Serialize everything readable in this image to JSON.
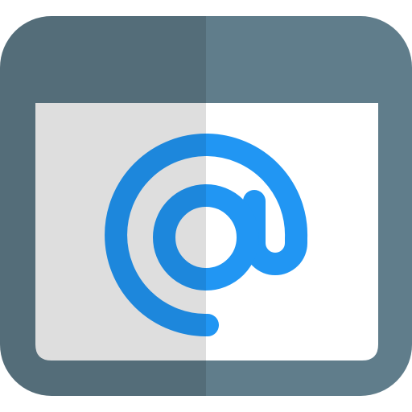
{
  "icon": {
    "name": "email-at-window-icon",
    "colors": {
      "frame_light": "#607D8B",
      "frame_dark": "#546D79",
      "content_light": "#FFFFFF",
      "content_dark": "#DEDEDE",
      "at_light": "#2196F3",
      "at_dark": "#1D87DC"
    }
  }
}
